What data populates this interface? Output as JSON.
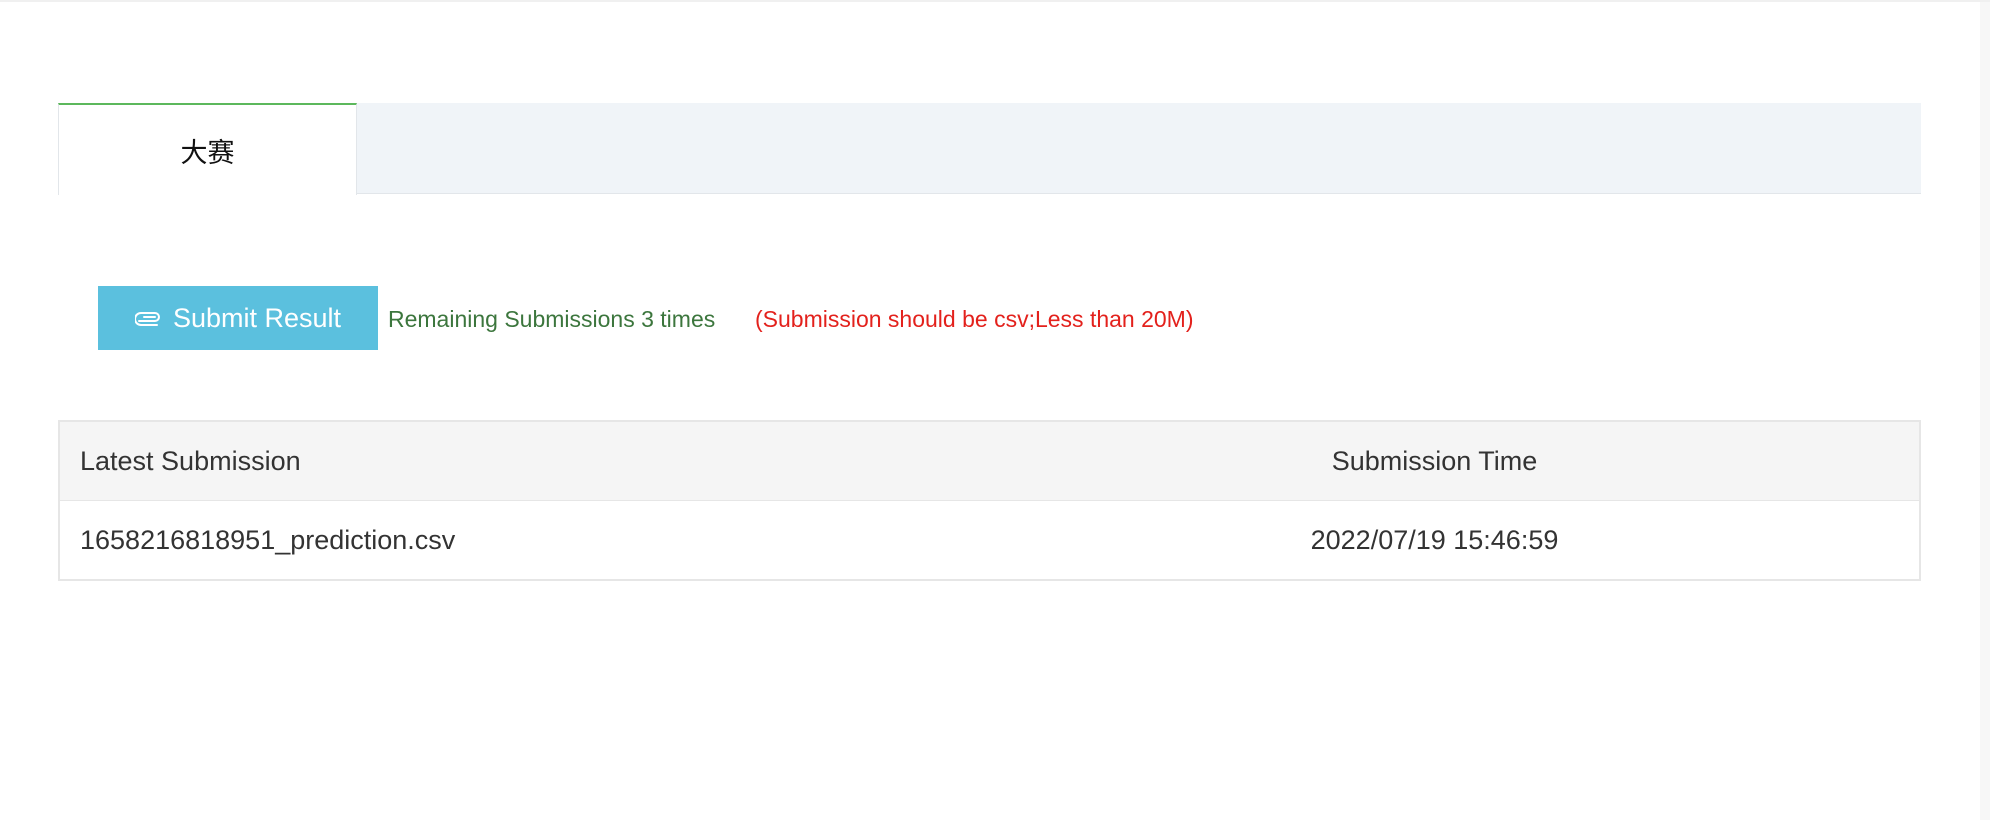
{
  "tabs": [
    {
      "label": "大赛",
      "active": true
    }
  ],
  "submit": {
    "button_label": "Submit Result",
    "icon": "paperclip-icon",
    "remaining_text": "Remaining Submissions 3 times",
    "requirement_text": "(Submission should be csv;Less than 20M)"
  },
  "table": {
    "headers": [
      "Latest Submission",
      "Submission Time"
    ],
    "rows": [
      [
        "1658216818951_prediction.csv",
        "2022/07/19 15:46:59"
      ]
    ]
  },
  "colors": {
    "tab_active_border": "#5cb85c",
    "button_bg": "#5bc0de",
    "remaining_text": "#3c763d",
    "requirement_text": "#e3211c",
    "table_header_bg": "#f5f5f5"
  }
}
